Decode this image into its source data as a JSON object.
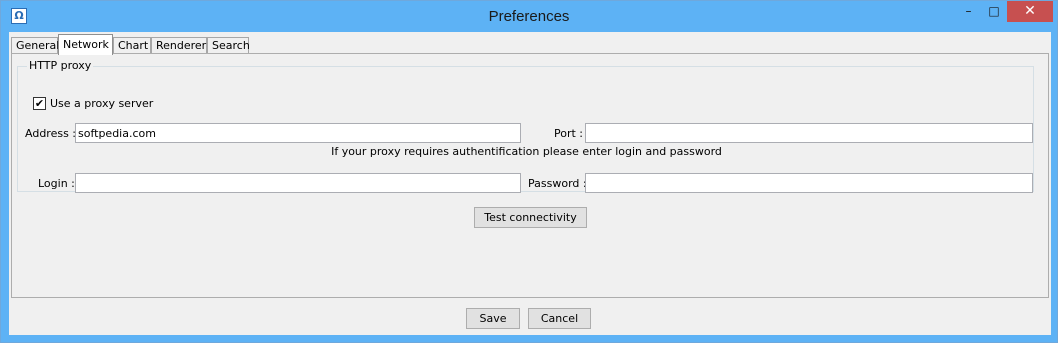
{
  "window": {
    "title": "Preferences",
    "minimize_glyph": "–",
    "maximize_glyph": "□",
    "close_glyph": "✕",
    "icon": "app-icon"
  },
  "tabs": [
    {
      "label": "General",
      "active": false
    },
    {
      "label": "Network",
      "active": true
    },
    {
      "label": "Chart",
      "active": false
    },
    {
      "label": "Renderer",
      "active": false
    },
    {
      "label": "Search",
      "active": false
    }
  ],
  "proxy": {
    "group_label": "HTTP proxy",
    "use_proxy_label": "Use a proxy server",
    "use_proxy_checked": true,
    "checkmark": "✔",
    "address_label": "Address :",
    "address_value": "softpedia.com",
    "port_label": "Port :",
    "port_value": "",
    "auth_info": "If your proxy requires authentification please enter login and password",
    "login_label": "Login :",
    "login_value": "",
    "password_label": "Password :",
    "password_value": ""
  },
  "test_button": "Test connectivity",
  "footer": {
    "save": "Save",
    "cancel": "Cancel"
  }
}
